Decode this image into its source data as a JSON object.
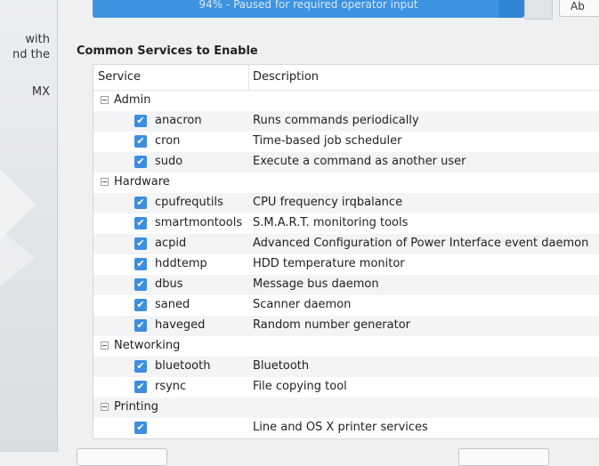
{
  "sidebar": {
    "lines": [
      "with",
      "nd the",
      "MX"
    ]
  },
  "progress": {
    "text": "94% - Paused for required operator input",
    "percent": 94
  },
  "abort_label": "Ab",
  "section_title": "Common Services to Enable",
  "table": {
    "headers": [
      "Service",
      "Description"
    ],
    "groups": [
      {
        "name": "Admin",
        "services": [
          {
            "name": "anacron",
            "desc": "Runs commands periodically",
            "checked": true
          },
          {
            "name": "cron",
            "desc": "Time-based job scheduler",
            "checked": true
          },
          {
            "name": "sudo",
            "desc": "Execute a command as another user",
            "checked": true
          }
        ]
      },
      {
        "name": "Hardware",
        "services": [
          {
            "name": "cpufrequtils",
            "desc": "CPU frequency irqbalance",
            "checked": true
          },
          {
            "name": "smartmontools",
            "desc": "S.M.A.R.T. monitoring tools",
            "checked": true
          },
          {
            "name": "acpid",
            "desc": "Advanced Configuration of Power Interface event daemon",
            "checked": true
          },
          {
            "name": "hddtemp",
            "desc": "HDD temperature monitor",
            "checked": true
          },
          {
            "name": "dbus",
            "desc": "Message bus daemon",
            "checked": true
          },
          {
            "name": "saned",
            "desc": "Scanner daemon",
            "checked": true
          },
          {
            "name": "haveged",
            "desc": "Random number generator",
            "checked": true
          }
        ]
      },
      {
        "name": "Networking",
        "services": [
          {
            "name": "bluetooth",
            "desc": "Bluetooth",
            "checked": true
          },
          {
            "name": "rsync",
            "desc": "File copying tool",
            "checked": true
          }
        ]
      },
      {
        "name": "Printing",
        "services": [
          {
            "name": "",
            "desc": "Line and OS X printer services",
            "checked": true
          }
        ]
      }
    ]
  },
  "colors": {
    "accent": "#3d8ee0",
    "progress": "#2f86d6"
  },
  "icons": {
    "expander": "minus-square-icon",
    "checkbox": "checkmark-icon"
  }
}
